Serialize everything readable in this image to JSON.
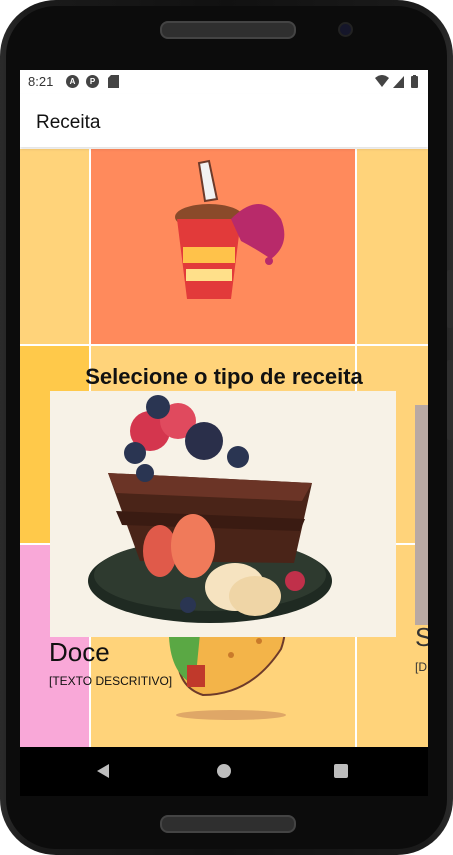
{
  "status_bar": {
    "time": "8:21",
    "icons": [
      "assistant-icon",
      "sync-icon",
      "sd-card-icon",
      "wifi-icon",
      "signal-icon",
      "battery-icon"
    ]
  },
  "app_bar": {
    "title": "Receita"
  },
  "main": {
    "heading": "Selecione o tipo de receita",
    "selected_card": {
      "title": "Doce",
      "description": "[TEXTO DESCRITIVO]",
      "image": "chocolate-cake-illustration"
    },
    "next_card": {
      "title": "S",
      "description": "[D"
    },
    "background_tiles": [
      "drink-illustration",
      "taco-illustration"
    ]
  },
  "nav_bar": {
    "buttons": [
      "back-button",
      "home-button",
      "recents-button"
    ]
  },
  "colors": {
    "tile_orange": "#ff8a5c",
    "tile_yellow": "#ffd37a",
    "tile_pink": "#f9a8d8",
    "card_bg": "#f7f2e7"
  }
}
